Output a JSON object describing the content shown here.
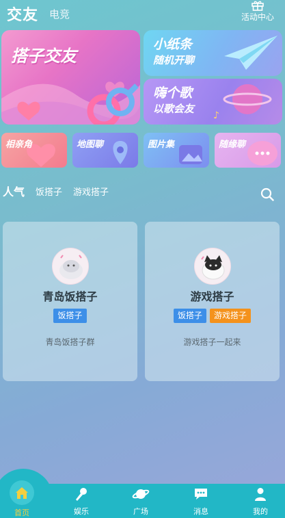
{
  "header": {
    "tab_main": "交友",
    "tab_sub": "电竞",
    "activity_label": "活动中心"
  },
  "banners": {
    "big": {
      "title": "搭子交友"
    },
    "right_top": {
      "title": "小纸条",
      "subtitle": "随机开聊"
    },
    "right_bottom": {
      "title": "嗨个歌",
      "subtitle": "以歌会友"
    }
  },
  "tiles": [
    {
      "label": "相亲角"
    },
    {
      "label": "地图聊"
    },
    {
      "label": "图片集"
    },
    {
      "label": "随缘聊"
    }
  ],
  "tabs": {
    "active": "人气",
    "items": [
      "饭搭子",
      "游戏搭子"
    ]
  },
  "cards": [
    {
      "title": "青岛饭搭子",
      "tags": [
        "饭搭子"
      ],
      "desc": "青岛饭搭子群"
    },
    {
      "title": "游戏搭子",
      "tags": [
        "饭搭子",
        "游戏搭子"
      ],
      "desc": "游戏搭子一起来"
    }
  ],
  "nav": [
    {
      "label": "首页",
      "icon": "home-icon"
    },
    {
      "label": "娱乐",
      "icon": "microphone-icon"
    },
    {
      "label": "广场",
      "icon": "planet-icon"
    },
    {
      "label": "消息",
      "icon": "chat-icon"
    },
    {
      "label": "我的",
      "icon": "user-icon"
    }
  ],
  "colors": {
    "nav_bg": "#22b7c6",
    "home_active": "#f4cf3f",
    "tag_blue": "#3d8fe8",
    "tag_orange": "#f4921c"
  }
}
